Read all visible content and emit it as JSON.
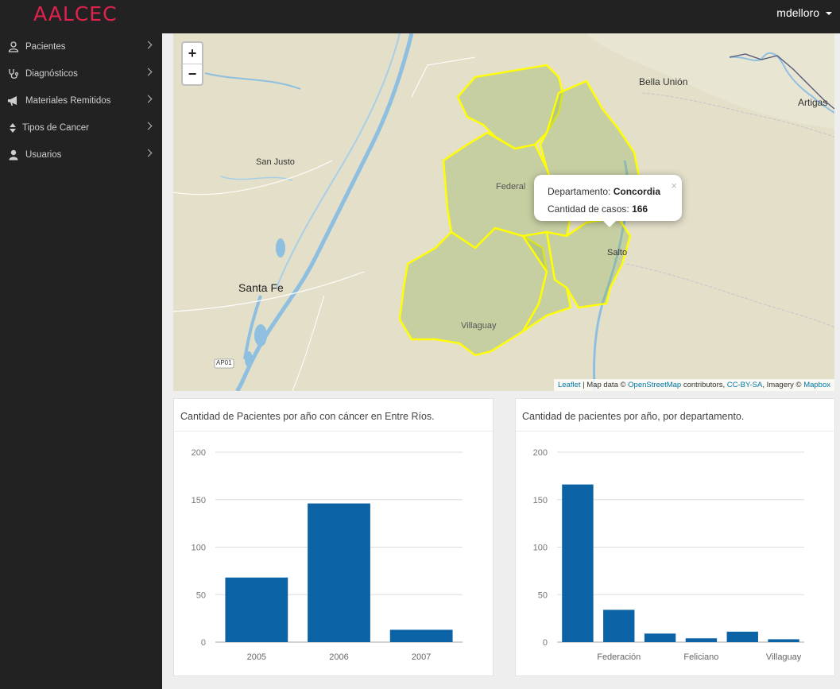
{
  "header": {
    "brand": "AALCEC",
    "user": "mdelloro"
  },
  "sidebar": {
    "items": [
      {
        "label": "Pacientes",
        "icon": "user-icon"
      },
      {
        "label": "Diagnósticos",
        "icon": "stethoscope-icon"
      },
      {
        "label": "Materiales Remitidos",
        "icon": "bullhorn-icon"
      },
      {
        "label": "Tipos de Cancer",
        "icon": "sort-icon"
      },
      {
        "label": "Usuarios",
        "icon": "user-solid-icon"
      }
    ]
  },
  "map": {
    "zoom_in": "+",
    "zoom_out": "−",
    "place_labels": [
      "Bella Unión",
      "Artigas",
      "San Justo",
      "Federal",
      "Salto",
      "Santa Fe",
      "Villaguay",
      "AP01"
    ],
    "popup": {
      "close": "×",
      "dept_label": "Departamento: ",
      "dept_value": "Concordia",
      "cases_label": "Cantidad de casos: ",
      "cases_value": "166"
    },
    "attribution": {
      "leaflet": "Leaflet",
      "text1": " | Map data © ",
      "osm": "OpenStreetMap",
      "text2": " contributors, ",
      "license": "CC-BY-SA",
      "text3": ", Imagery © ",
      "mapbox": "Mapbox"
    },
    "colors": {
      "region_stroke": "#ffff00",
      "region_fill": "#8fb35a"
    }
  },
  "chart_data": [
    {
      "type": "bar",
      "title": "Cantidad de Pacientes por año con cáncer en Entre Ríos.",
      "categories": [
        "2005",
        "2006",
        "2007"
      ],
      "values": [
        68,
        146,
        13
      ],
      "ylim": [
        0,
        200
      ],
      "yticks": [
        0,
        50,
        100,
        150,
        200
      ],
      "grid": true,
      "bar_color": "#0b62a4"
    },
    {
      "type": "bar",
      "title": "Cantidad de pacientes por año, por departamento.",
      "categories": [
        "",
        "Federación",
        "",
        "Feliciano",
        "",
        "Villaguay"
      ],
      "values": [
        166,
        34,
        9,
        4,
        11,
        3
      ],
      "ylim": [
        0,
        200
      ],
      "yticks": [
        0,
        50,
        100,
        150,
        200
      ],
      "grid": true,
      "bar_color": "#0b62a4"
    }
  ]
}
